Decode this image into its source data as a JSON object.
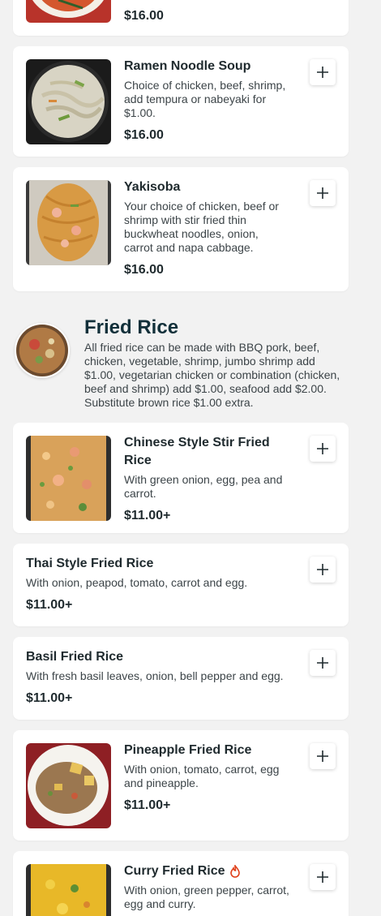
{
  "colors": {
    "background": "#f2f2f2",
    "card": "#ffffff",
    "text": "#1f2a2e",
    "section_title": "#12303a",
    "spicy": "#e0401a"
  },
  "top_item": {
    "price": "$16.00"
  },
  "noodle_items": [
    {
      "name": "Ramen Noodle Soup",
      "description": "Choice of chicken, beef, shrimp, add tempura or nabeyaki for $1.00.",
      "price": "$16.00",
      "icon": "plus-icon"
    },
    {
      "name": "Yakisoba",
      "description": "Your choice of chicken, beef or shrimp with stir fried thin buckwheat noodles, onion, carrot and napa cabbage.",
      "price": "$16.00",
      "icon": "plus-icon"
    }
  ],
  "fried_rice_section": {
    "title": "Fried Rice",
    "description": "All fried rice can be made with BBQ pork, beef, chicken, vegetable, shrimp, jumbo shrimp add $1.00, vegetarian chicken or combination (chicken, beef and shrimp) add $1.00, seafood add $2.00. Substitute brown rice $1.00 extra.",
    "items": [
      {
        "name": "Chinese Style Stir Fried Rice",
        "description": "With green onion, egg, pea and carrot.",
        "price": "$11.00+"
      },
      {
        "name": "Thai Style Fried Rice",
        "description": "With onion, peapod, tomato, carrot and egg.",
        "price": "$11.00+"
      },
      {
        "name": "Basil Fried Rice",
        "description": "With fresh basil leaves, onion, bell pepper and egg.",
        "price": "$11.00+"
      },
      {
        "name": "Pineapple Fried Rice",
        "description": "With onion, tomato, carrot, egg and pineapple.",
        "price": "$11.00+"
      },
      {
        "name": "Curry Fried Rice",
        "description": "With onion, green pepper, carrot, egg and curry.",
        "spicy_icon": "flame-icon"
      }
    ]
  }
}
